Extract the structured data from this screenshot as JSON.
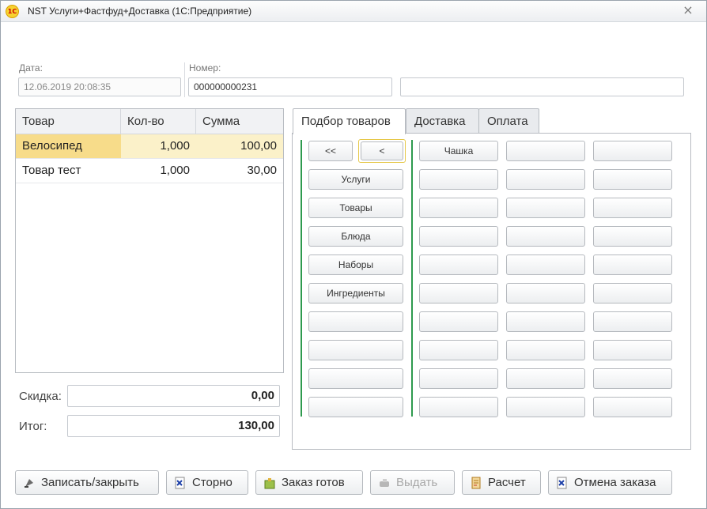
{
  "window": {
    "title": "NST Услуги+Фастфуд+Доставка  (1С:Предприятие)",
    "logo_text": "1C",
    "close_glyph": "×"
  },
  "header": {
    "date_label": "Дата:",
    "date_value": "12.06.2019 20:08:35",
    "number_label": "Номер:",
    "number_value": "000000000231",
    "extra_value": ""
  },
  "table": {
    "columns": [
      "Товар",
      "Кол-во",
      "Сумма"
    ],
    "rows": [
      {
        "item": "Велосипед",
        "qty": "1,000",
        "sum": "100,00"
      },
      {
        "item": "Товар тест",
        "qty": "1,000",
        "sum": "30,00"
      }
    ]
  },
  "totals": {
    "discount_label": "Скидка:",
    "discount_value": "0,00",
    "total_label": "Итог:",
    "total_value": "130,00"
  },
  "tabs": [
    "Подбор товаров",
    "Доставка",
    "Оплата"
  ],
  "selection": {
    "nav_first": "<<",
    "nav_prev": "<",
    "groups": [
      "Услуги",
      "Товары",
      "Блюда",
      "Наборы",
      "Ингредиенты"
    ],
    "products": [
      "Чашка"
    ]
  },
  "actions": {
    "save_close": "Записать/закрыть",
    "storno": "Сторно",
    "order_ready": "Заказ готов",
    "issue": "Выдать",
    "payment": "Расчет",
    "cancel_order": "Отмена заказа"
  },
  "icons": {
    "save_close": "save-close-icon",
    "storno": "storno-icon",
    "order_ready": "order-ready-icon",
    "issue": "issue-icon",
    "payment": "payment-icon",
    "cancel_order": "cancel-order-icon"
  },
  "colors": {
    "selected_row": "#fbf1c9",
    "selected_cell": "#f7dc8a",
    "divider_green": "#2e9a4e"
  }
}
